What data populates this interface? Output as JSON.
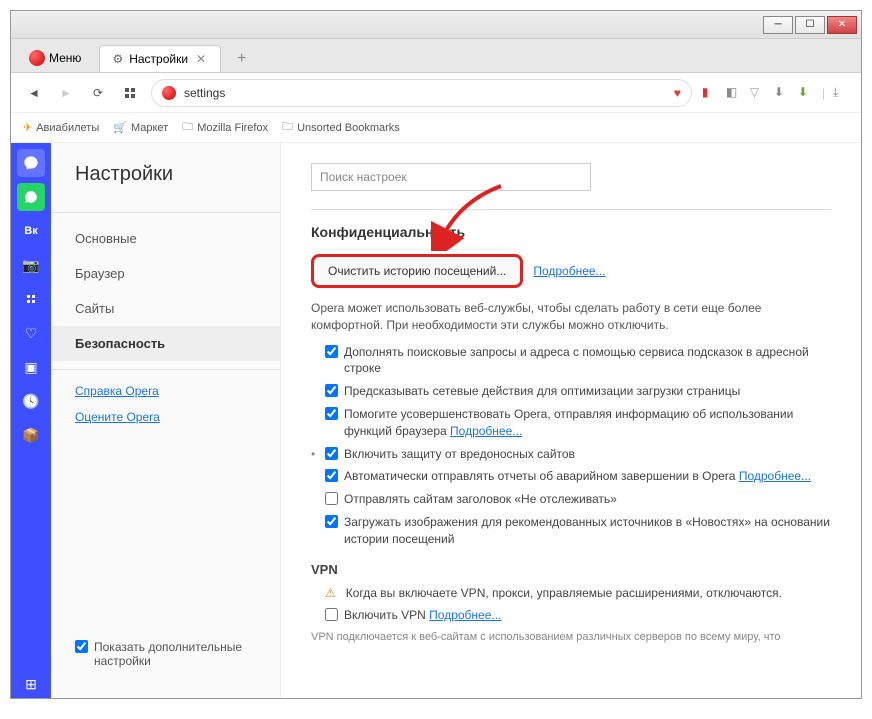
{
  "window": {
    "menu_label": "Меню",
    "tab_title": "Настройки"
  },
  "address": {
    "url": "settings"
  },
  "bookmarks": {
    "b1": "Авиабилеты",
    "b2": "Маркет",
    "b3": "Mozilla Firefox",
    "b4": "Unsorted Bookmarks"
  },
  "settings": {
    "title": "Настройки",
    "nav": {
      "basic": "Основные",
      "browser": "Браузер",
      "sites": "Сайты",
      "security": "Безопасность",
      "help": "Справка Opera",
      "rate": "Оцените Opera",
      "advanced": "Показать дополнительные настройки"
    }
  },
  "main": {
    "search_placeholder": "Поиск настроек",
    "privacy_h": "Конфиденциальность",
    "clear_btn": "Очистить историю посещений...",
    "more": "Подробнее...",
    "privacy_desc": "Opera может использовать веб-службы, чтобы сделать работу в сети еще более комфортной. При необходимости эти службы можно отключить.",
    "c1": "Дополнять поисковые запросы и адреса с помощью сервиса подсказок в адресной строке",
    "c2": "Предсказывать сетевые действия для оптимизации загрузки страницы",
    "c3a": "Помогите усовершенствовать Opera, отправляя информацию об использовании функций браузера ",
    "c4": "Включить защиту от вредоносных сайтов",
    "c5a": "Автоматически отправлять отчеты об аварийном завершении в Opera ",
    "c6": "Отправлять сайтам заголовок «Не отслеживать»",
    "c7": "Загружать изображения для рекомендованных источников в «Новостях» на основании истории посещений",
    "vpn_h": "VPN",
    "vpn_warn": "Когда вы включаете VPN, прокси, управляемые расширениями, отключаются.",
    "vpn_enable": "Включить VPN ",
    "vpn_desc": "VPN подключается к веб-сайтам с использованием различных серверов по всему миру, что"
  }
}
